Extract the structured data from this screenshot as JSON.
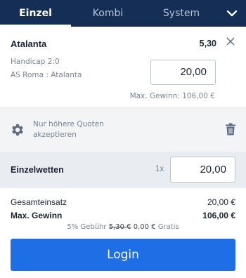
{
  "tabs": [
    {
      "label": "Einzel",
      "active": true
    },
    {
      "label": "Kombi",
      "active": false
    },
    {
      "label": "System",
      "active": false
    }
  ],
  "bet": {
    "team": "Atalanta",
    "odds": "5,30",
    "market": "Handicap 2:0",
    "match": "AS Roma : Atalanta",
    "stake": "20,00",
    "max_win": "Max. Gewinn: 106,00 €"
  },
  "settings": {
    "accept_line1": "Nur höhere Quoten",
    "accept_line2": "akzeptieren"
  },
  "single": {
    "label": "Einzelwetten",
    "multiplier": "1x",
    "stake": "20,00"
  },
  "summary": {
    "total_label": "Gesamteinsatz",
    "total_value": "20,00 €",
    "max_label": "Max. Gewinn",
    "max_value": "106,00 €",
    "fee_prefix": "5% Gebühr",
    "fee_old": "5,30 €",
    "fee_new": "0,00 €",
    "fee_suffix": "Gratis"
  },
  "login_label": "Login",
  "colors": {
    "header_bg": "#152e55",
    "accent": "#1e6ee6",
    "muted_text": "#7a8494"
  }
}
